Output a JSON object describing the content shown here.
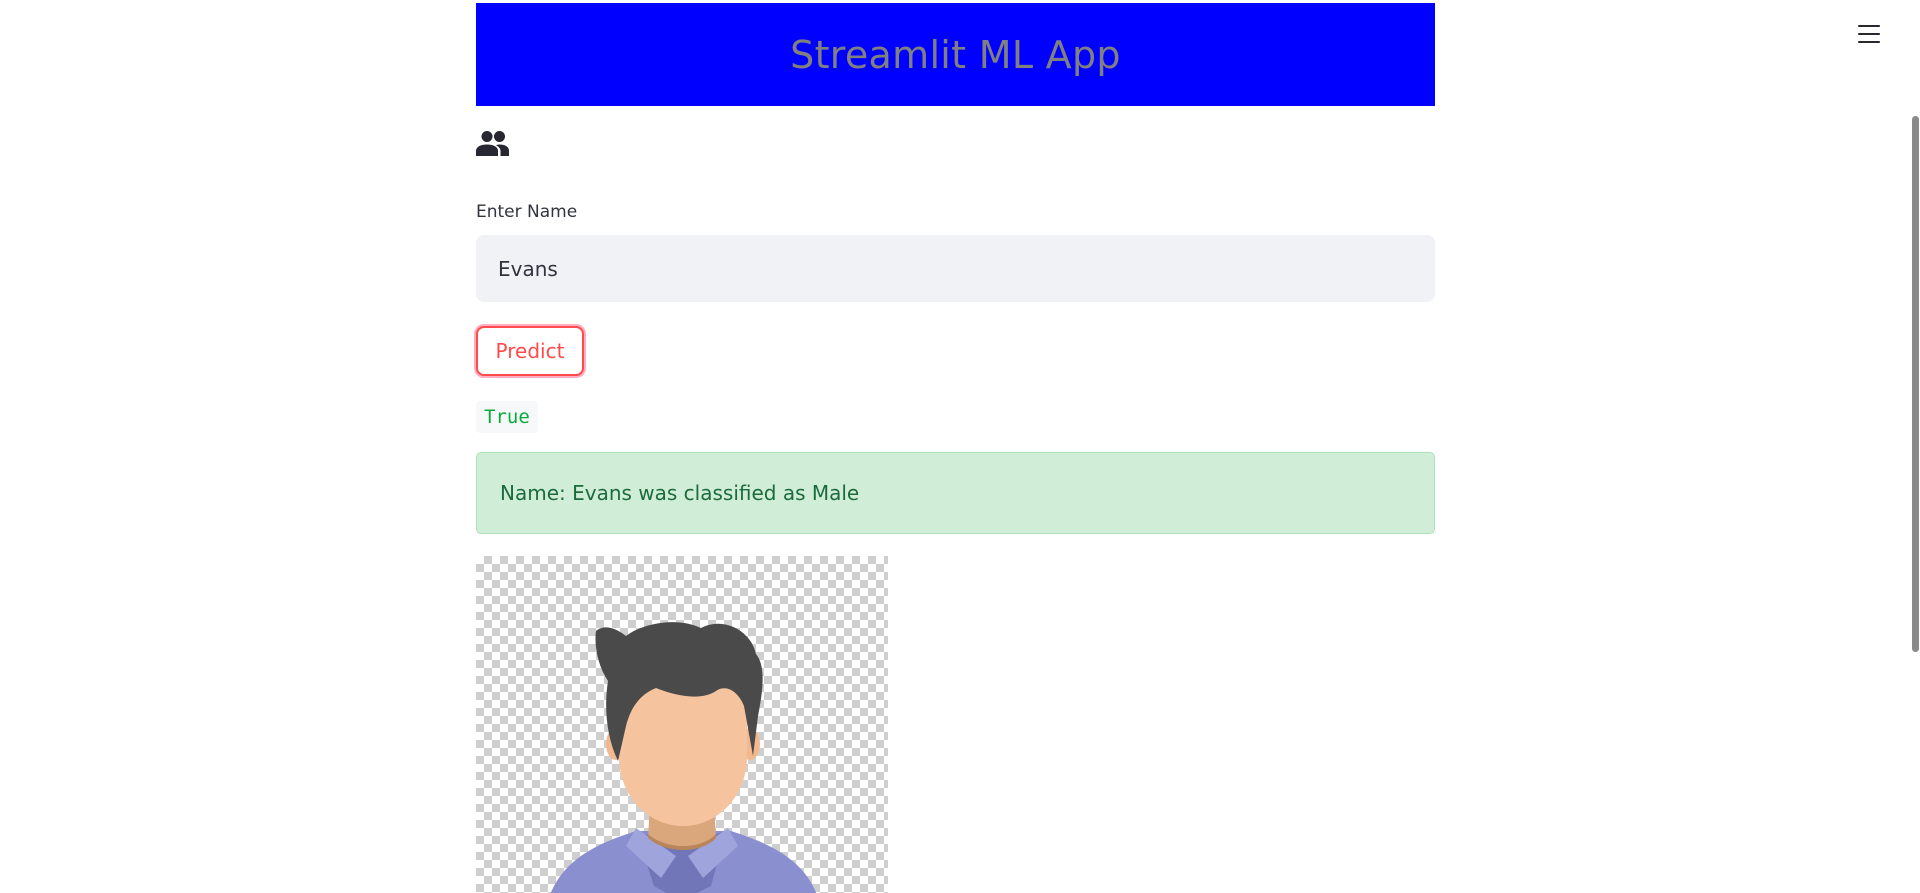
{
  "app": {
    "title": "Streamlit ML App",
    "banner_color": "#0000ff",
    "title_color": "#808080"
  },
  "icons": {
    "header": "people-icon",
    "menu": "hamburger-menu-icon",
    "avatar": "male-avatar-image"
  },
  "form": {
    "name_label": "Enter Name",
    "name_value": "Evans",
    "predict_label": "Predict"
  },
  "output": {
    "code_value": "True",
    "success_message": "Name: Evans was classified as Male",
    "success_color": "#d0edd8"
  },
  "colors": {
    "accent": "#ff4b4b",
    "input_bg": "#f0f2f6",
    "code_text": "#09ab3b"
  }
}
